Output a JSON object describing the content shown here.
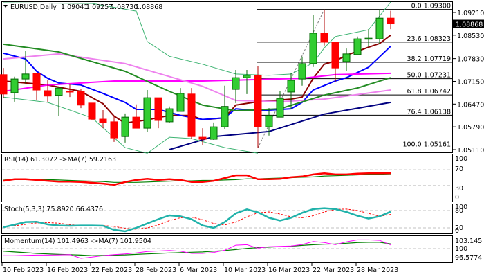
{
  "header": {
    "symbol_timeframe": "EURUSD,Daily",
    "open": "1.09041",
    "high": "1.09257",
    "low": "1.08730",
    "close": "1.08868",
    "menu_icon": "triangle-down-icon"
  },
  "colors": {
    "bull": "#32cd32",
    "bull_border": "#006400",
    "bear": "#ff0000",
    "bear_border": "#b00000",
    "rsi": "#ff0000",
    "rsi_ma": "#008000",
    "stoch_main": "#20b2aa",
    "stoch_signal": "#ff0000",
    "momentum": "#ff00ff",
    "momentum_ma": "#008000"
  },
  "chart_data": {
    "type": "candlestick",
    "symbol": "EURUSD",
    "timeframe": "Daily",
    "ylim": [
      1.0495,
      1.0957
    ],
    "current_price": "1.08868",
    "price_axis": {
      "ticks": [
        "1.09210",
        "1.08530",
        "1.07830",
        "1.07150",
        "1.06470",
        "1.05790",
        "1.05110"
      ]
    },
    "dates": [
      {
        "label": "10 Feb 2023",
        "index": 0
      },
      {
        "label": "16 Feb 2023",
        "index": 4
      },
      {
        "label": "22 Feb 2023",
        "index": 8
      },
      {
        "label": "28 Feb 2023",
        "index": 12
      },
      {
        "label": "6 Mar 2023",
        "index": 16
      },
      {
        "label": "10 Mar 2023",
        "index": 20
      },
      {
        "label": "16 Mar 2023",
        "index": 24
      },
      {
        "label": "22 Mar 2023",
        "index": 28
      },
      {
        "label": "28 Mar 2023",
        "index": 32
      }
    ],
    "candles": [
      [
        1.0735,
        1.0755,
        1.0666,
        1.0677
      ],
      [
        1.0681,
        1.0729,
        1.0654,
        1.0722
      ],
      [
        1.0722,
        1.0805,
        1.0708,
        1.0737
      ],
      [
        1.0739,
        1.0739,
        1.0658,
        1.0689
      ],
      [
        1.0687,
        1.072,
        1.0654,
        1.0671
      ],
      [
        1.0673,
        1.0695,
        1.0611,
        1.0695
      ],
      [
        1.0686,
        1.0706,
        1.0668,
        1.0685
      ],
      [
        1.0685,
        1.0693,
        1.0635,
        1.0644
      ],
      [
        1.065,
        1.065,
        1.0598,
        1.0602
      ],
      [
        1.0602,
        1.0629,
        1.0575,
        1.0592
      ],
      [
        1.0594,
        1.0613,
        1.0534,
        1.0546
      ],
      [
        1.055,
        1.0619,
        1.0532,
        1.0608
      ],
      [
        1.0608,
        1.0646,
        1.0575,
        1.0575
      ],
      [
        1.0575,
        1.0689,
        1.0563,
        1.0666
      ],
      [
        1.0666,
        1.0666,
        1.0575,
        1.0598
      ],
      [
        1.0594,
        1.064,
        1.059,
        1.0633
      ],
      [
        1.0625,
        1.0695,
        1.0625,
        1.0679
      ],
      [
        1.0677,
        1.0695,
        1.0544,
        1.055
      ],
      [
        1.0548,
        1.0575,
        1.0524,
        1.0542
      ],
      [
        1.0542,
        1.0592,
        1.054,
        1.0579
      ],
      [
        1.0579,
        1.0702,
        1.0573,
        1.064
      ],
      [
        1.0691,
        1.0749,
        1.065,
        1.0726
      ],
      [
        1.0726,
        1.0749,
        1.0677,
        1.0733
      ],
      [
        1.0733,
        1.076,
        1.0516,
        1.0579
      ],
      [
        1.0579,
        1.0635,
        1.0553,
        1.0613
      ],
      [
        1.0608,
        1.0685,
        1.0608,
        1.0664
      ],
      [
        1.0683,
        1.0739,
        1.0633,
        1.0718
      ],
      [
        1.0722,
        1.0789,
        1.0702,
        1.0768
      ],
      [
        1.0768,
        1.0913,
        1.0758,
        1.0859
      ],
      [
        1.0859,
        1.093,
        1.0822,
        1.0832
      ],
      [
        1.0832,
        1.0834,
        1.0714,
        1.0755
      ],
      [
        1.0774,
        1.0813,
        1.0747,
        1.0797
      ],
      [
        1.0795,
        1.0849,
        1.0795,
        1.0842
      ],
      [
        1.0843,
        1.0871,
        1.0818,
        1.0844
      ],
      [
        1.0842,
        1.093,
        1.0826,
        1.0904
      ],
      [
        1.0904,
        1.0926,
        1.0871,
        1.08868
      ]
    ],
    "overlays": [
      {
        "name": "ma-darkred",
        "color": "#8b0000",
        "width": 2,
        "points": [
          [
            0,
            1.0716
          ],
          [
            4,
            1.0704
          ],
          [
            7,
            1.0685
          ],
          [
            9,
            1.0648
          ],
          [
            10,
            1.0611
          ],
          [
            11,
            1.059
          ],
          [
            13,
            1.06
          ],
          [
            15,
            1.0613
          ],
          [
            17,
            1.0613
          ],
          [
            18,
            1.06
          ],
          [
            20,
            1.0606
          ],
          [
            21,
            1.0644
          ],
          [
            23,
            1.0654
          ],
          [
            26,
            1.0662
          ],
          [
            27,
            1.0668
          ],
          [
            28,
            1.0724
          ],
          [
            29,
            1.0766
          ],
          [
            30,
            1.0776
          ],
          [
            31,
            1.0793
          ],
          [
            33,
            1.0817
          ],
          [
            34,
            1.0828
          ],
          [
            35,
            1.0853
          ]
        ]
      },
      {
        "name": "ma-blue",
        "color": "#0000ff",
        "width": 2,
        "points": [
          [
            0,
            1.0799
          ],
          [
            2,
            1.0782
          ],
          [
            3,
            1.0745
          ],
          [
            4,
            1.0724
          ],
          [
            5,
            1.071
          ],
          [
            7,
            1.0704
          ],
          [
            9,
            1.0679
          ],
          [
            11,
            1.0652
          ],
          [
            12,
            1.0631
          ],
          [
            14,
            1.0631
          ],
          [
            16,
            1.0613
          ],
          [
            18,
            1.0601
          ],
          [
            20,
            1.0606
          ],
          [
            21,
            1.0633
          ],
          [
            23,
            1.0627
          ],
          [
            26,
            1.0633
          ],
          [
            27,
            1.0652
          ],
          [
            28,
            1.0689
          ],
          [
            30,
            1.0716
          ],
          [
            31,
            1.0726
          ],
          [
            33,
            1.0757
          ],
          [
            35,
            1.082
          ]
        ]
      },
      {
        "name": "ma-magenta",
        "color": "#ff00ff",
        "width": 2,
        "points": [
          [
            0,
            1.0685
          ],
          [
            4,
            1.0704
          ],
          [
            10,
            1.0716
          ],
          [
            18,
            1.0716
          ],
          [
            27,
            1.0724
          ],
          [
            30,
            1.0735
          ],
          [
            35,
            1.0739
          ]
        ]
      },
      {
        "name": "ma-violet",
        "color": "#ee82ee",
        "width": 2,
        "points": [
          [
            0,
            1.0782
          ],
          [
            5,
            1.0797
          ],
          [
            11,
            1.0768
          ],
          [
            17,
            1.071
          ],
          [
            18,
            1.07
          ],
          [
            21,
            1.0658
          ],
          [
            25,
            1.0654
          ],
          [
            29,
            1.0662
          ],
          [
            35,
            1.0689
          ]
        ]
      },
      {
        "name": "ma-green",
        "color": "#228b22",
        "width": 2,
        "points": [
          [
            0,
            1.0826
          ],
          [
            5,
            1.0803
          ],
          [
            11,
            1.0745
          ],
          [
            15,
            1.0685
          ],
          [
            18,
            1.0644
          ],
          [
            21,
            1.0627
          ],
          [
            25,
            1.0633
          ],
          [
            29,
            1.0674
          ],
          [
            32,
            1.0695
          ],
          [
            35,
            1.0726
          ]
        ]
      },
      {
        "name": "ma-navy",
        "color": "#000080",
        "width": 2,
        "points": [
          [
            15,
            1.0511
          ],
          [
            19,
            1.055
          ],
          [
            24,
            1.0565
          ],
          [
            29,
            1.0617
          ],
          [
            35,
            1.0652
          ]
        ]
      },
      {
        "name": "bollinger-upper",
        "color": "#3cb371",
        "width": 1,
        "points": [
          [
            0,
            1.095
          ],
          [
            8,
            1.0948
          ],
          [
            12,
            1.0925
          ],
          [
            13,
            1.0834
          ],
          [
            15,
            1.079
          ],
          [
            18,
            1.0766
          ],
          [
            21,
            1.0737
          ],
          [
            24,
            1.0733
          ],
          [
            26,
            1.0737
          ],
          [
            28,
            1.077
          ],
          [
            29,
            1.0815
          ],
          [
            30,
            1.0849
          ],
          [
            33,
            1.0869
          ],
          [
            35,
            1.0952
          ]
        ]
      },
      {
        "name": "bollinger-lower",
        "color": "#3cb371",
        "width": 1,
        "points": [
          [
            0,
            1.0668
          ],
          [
            4,
            1.0652
          ],
          [
            8,
            1.0606
          ],
          [
            11,
            1.0517
          ],
          [
            13,
            1.05
          ],
          [
            15,
            1.0548
          ],
          [
            17,
            1.0544
          ],
          [
            20,
            1.0517
          ],
          [
            23,
            1.05
          ]
        ]
      }
    ],
    "fibonacci": {
      "anchor_low_index": 23,
      "anchor_high_index": 29,
      "levels": [
        {
          "pct": "0.0",
          "price": "1.09300"
        },
        {
          "pct": "23.6",
          "price": "1.08323"
        },
        {
          "pct": "38.2",
          "price": "1.07719"
        },
        {
          "pct": "50.0",
          "price": "1.07231"
        },
        {
          "pct": "61.8",
          "price": "1.06742"
        },
        {
          "pct": "76.4",
          "price": "1.06138"
        },
        {
          "pct": "100.0",
          "price": "1.05161"
        }
      ]
    },
    "indicators": {
      "rsi": {
        "title": "RSI(14) 61.3072  ->MA(7) 59.2163",
        "scale": [
          "100",
          "70",
          "30",
          "0"
        ],
        "range": [
          0,
          100
        ],
        "levels": [
          70,
          30
        ],
        "values": [
          42,
          46,
          46,
          44,
          42,
          40,
          40,
          39,
          37,
          35,
          32,
          39,
          44,
          47,
          44,
          46,
          44,
          39,
          39,
          42,
          49,
          56,
          56,
          46,
          46,
          47,
          51,
          53,
          58,
          61,
          58,
          58,
          60,
          61,
          61,
          61.3072
        ],
        "ma": [
          46,
          46,
          46,
          45,
          45,
          44,
          43,
          42,
          41,
          40,
          38,
          38,
          38,
          39,
          40,
          41,
          42,
          42,
          43,
          43,
          44,
          45,
          47,
          47,
          48,
          49,
          50,
          51,
          52,
          54,
          55,
          56,
          57,
          58,
          58.8,
          59.2163
        ]
      },
      "stoch": {
        "title": "Stoch(5,3,3) 75.8920 66.4376",
        "scale": [
          "100",
          "80",
          "20",
          "0"
        ],
        "range": [
          0,
          100
        ],
        "levels": [
          80,
          20
        ],
        "values": [
          22,
          31,
          40,
          41,
          32,
          28,
          27,
          28,
          28,
          27,
          13,
          8,
          20,
          35,
          50,
          63,
          60,
          50,
          28,
          20,
          40,
          70,
          84,
          74,
          55,
          45,
          55,
          72,
          85,
          88,
          85,
          75,
          62,
          52,
          60,
          75.892
        ],
        "signal": [
          25,
          27,
          32,
          37,
          38,
          36,
          31,
          28,
          28,
          28,
          25,
          18,
          15,
          20,
          30,
          45,
          55,
          57,
          48,
          35,
          30,
          40,
          58,
          72,
          75,
          68,
          58,
          55,
          62,
          75,
          84,
          85,
          80,
          70,
          60,
          66.4376
        ]
      },
      "momentum": {
        "title": "Momentum(14) 101.4963  ->MA(7) 101.9504",
        "scale": [
          "103.145",
          "100",
          "96.5774"
        ],
        "level": 100,
        "values": [
          97.1,
          97.1,
          97.2,
          97.3,
          97.3,
          97.4,
          97.5,
          96.0,
          96.5,
          97.1,
          97.5,
          97.8,
          98.2,
          98.8,
          99.0,
          99.2,
          98.9,
          98.0,
          98.0,
          98.4,
          99.3,
          101.4,
          101.6,
          100.2,
          100.8,
          100.9,
          101.1,
          101.7,
          102.9,
          102.5,
          101.6,
          102.8,
          103.6,
          103.6,
          103.4,
          101.4963
        ],
        "ma": [
          98.9,
          98.6,
          98.3,
          98.0,
          97.8,
          97.6,
          97.5,
          97.3,
          97.1,
          97.2,
          97.3,
          97.4,
          97.6,
          97.8,
          98.0,
          98.2,
          98.3,
          98.5,
          98.6,
          98.9,
          99.2,
          99.6,
          100.1,
          100.4,
          100.6,
          100.8,
          101.0,
          101.3,
          101.6,
          101.8,
          101.9,
          102.2,
          102.5,
          102.6,
          102.6,
          101.9504
        ]
      }
    }
  }
}
